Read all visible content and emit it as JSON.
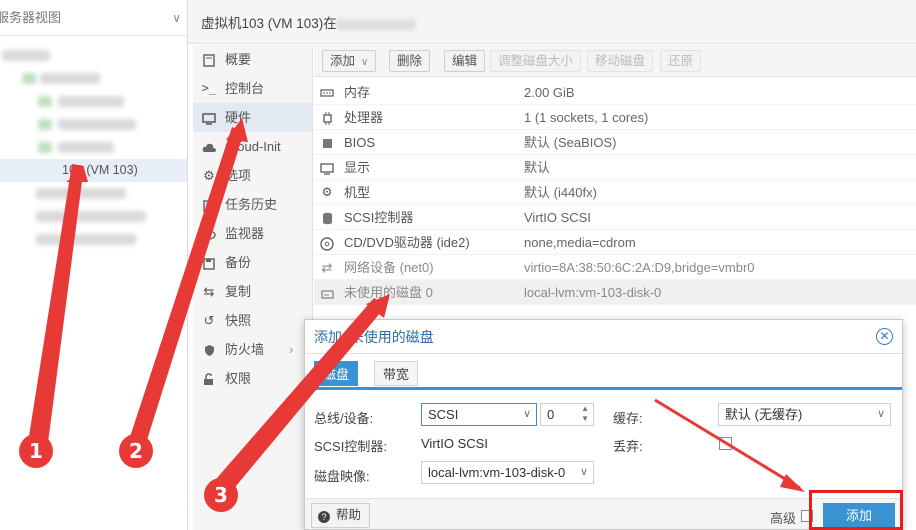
{
  "tree": {
    "header": "服务器视图",
    "selected_vm": "103 (VM 103)"
  },
  "title": {
    "text": "虚拟机103 (VM 103)在"
  },
  "nav": {
    "items": [
      {
        "label": "概要",
        "icon": "book-icon"
      },
      {
        "label": "控制台",
        "icon": "terminal-icon"
      },
      {
        "label": "硬件",
        "icon": "monitor-icon"
      },
      {
        "label": "Cloud-Init",
        "icon": "cloud-icon"
      },
      {
        "label": "选项",
        "icon": "gear-icon"
      },
      {
        "label": "任务历史",
        "icon": "list-icon"
      },
      {
        "label": "监视器",
        "icon": "eye-icon"
      },
      {
        "label": "备份",
        "icon": "floppy-icon"
      },
      {
        "label": "复制",
        "icon": "retweet-icon"
      },
      {
        "label": "快照",
        "icon": "history-icon"
      },
      {
        "label": "防火墙",
        "icon": "shield-icon"
      },
      {
        "label": "权限",
        "icon": "unlock-icon"
      }
    ],
    "active_index": 2
  },
  "toolbar": {
    "add": "添加",
    "remove": "删除",
    "edit": "编辑",
    "resize": "调整磁盘大小",
    "move": "移动磁盘",
    "revert": "还原"
  },
  "hardware": [
    {
      "name": "内存",
      "value": "2.00 GiB",
      "icon": "memory-icon"
    },
    {
      "name": "处理器",
      "value": "1 (1 sockets, 1 cores)",
      "icon": "cpu-icon"
    },
    {
      "name": "BIOS",
      "value": "默认 (SeaBIOS)",
      "icon": "chip-icon"
    },
    {
      "name": "显示",
      "value": "默认",
      "icon": "desktop-icon"
    },
    {
      "name": "机型",
      "value": "默认 (i440fx)",
      "icon": "cogs-icon"
    },
    {
      "name": "SCSI控制器",
      "value": "VirtIO SCSI",
      "icon": "database-icon"
    },
    {
      "name": "CD/DVD驱动器 (ide2)",
      "value": "none,media=cdrom",
      "icon": "disc-icon"
    },
    {
      "name": "网络设备 (net0)",
      "value": "virtio=8A:38:50:6C:2A:D9,bridge=vmbr0",
      "icon": "exchange-icon"
    },
    {
      "name": "未使用的磁盘 0",
      "value": "local-lvm:vm-103-disk-0",
      "icon": "hdd-icon"
    }
  ],
  "modal": {
    "title": "添加: 未使用的磁盘",
    "tabs": [
      "磁盘",
      "带宽"
    ],
    "bus_label": "总线/设备:",
    "bus_value": "SCSI",
    "device_number": "0",
    "scsi_label": "SCSI控制器:",
    "scsi_value": "VirtIO SCSI",
    "image_label": "磁盘映像:",
    "image_value": "local-lvm:vm-103-disk-0",
    "cache_label": "缓存:",
    "cache_value": "默认 (无缓存)",
    "discard_label": "丢弃:",
    "help": "帮助",
    "advanced": "高级",
    "add": "添加"
  },
  "annotations": {
    "steps": [
      "1",
      "2",
      "3"
    ],
    "color": "#e73a36"
  }
}
